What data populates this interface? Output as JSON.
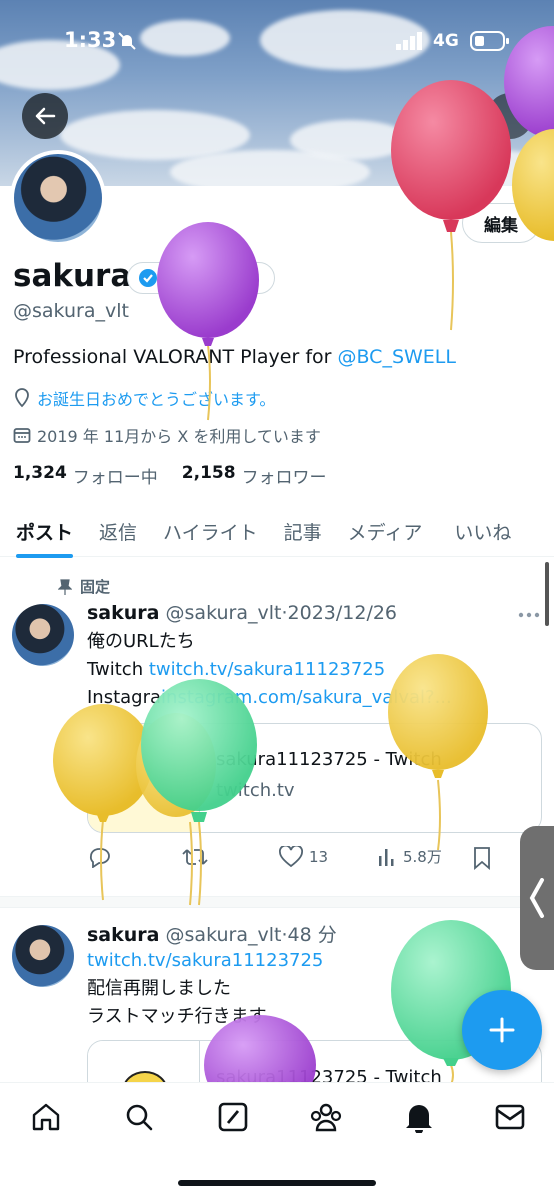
{
  "status_bar": {
    "time": "1:33",
    "network": "4G"
  },
  "profile": {
    "edit_label": "編集",
    "name": "sakura",
    "verify_label": "認証を受ける",
    "handle": "@sakura_vlt",
    "bio_text": "Professional VALORANT Player for ",
    "bio_link": "@BC_SWELL",
    "birthday_text": "お誕生日おめでとうございます。",
    "joined_text": "2019 年 11月から X を利用しています",
    "following_count": "1,324",
    "following_label": "フォロー中",
    "followers_count": "2,158",
    "followers_label": "フォロワー"
  },
  "tabs": [
    {
      "label": "ポスト"
    },
    {
      "label": "返信"
    },
    {
      "label": "ハイライト"
    },
    {
      "label": "記事"
    },
    {
      "label": "メディア"
    },
    {
      "label": "いいね"
    }
  ],
  "posts": [
    {
      "pinned_label": "固定",
      "name": "sakura",
      "handle": "@sakura_vlt",
      "time": "2023/12/26",
      "line1": "俺のURLたち",
      "line2_prefix": "Twitch ",
      "line2_link": "twitch.tv/sakura11123725",
      "line3_prefix": "Instagra",
      "line3_link": "instagram.com/sakura_valval?...",
      "card_title": "sakura11123725 - Twitch",
      "card_domain": "twitch.tv",
      "likes": "13",
      "views": "5.8万"
    },
    {
      "name": "sakura",
      "handle": "@sakura_vlt",
      "time": "48 分",
      "line1_link": "twitch.tv/sakura11123725",
      "line2": "配信再開しました",
      "line3": "ラストマッチ行きます",
      "card_title": "sakura11123725 - Twitch"
    }
  ],
  "colors": {
    "accent": "#1d9bf0",
    "balloon_red": "#e2486a",
    "balloon_purple": "#a84bd6",
    "balloon_yellow": "#f2ca3e",
    "balloon_green": "#5fe0a3"
  },
  "icons": [
    "back-arrow-icon",
    "verified-badge-icon",
    "location-pin-icon",
    "calendar-icon",
    "pin-icon",
    "more-icon",
    "reply-icon",
    "retweet-icon",
    "like-icon",
    "views-icon",
    "bookmark-icon",
    "plus-icon",
    "home-icon",
    "search-icon",
    "grok-icon",
    "communities-icon",
    "notifications-bell-icon",
    "messages-icon"
  ]
}
